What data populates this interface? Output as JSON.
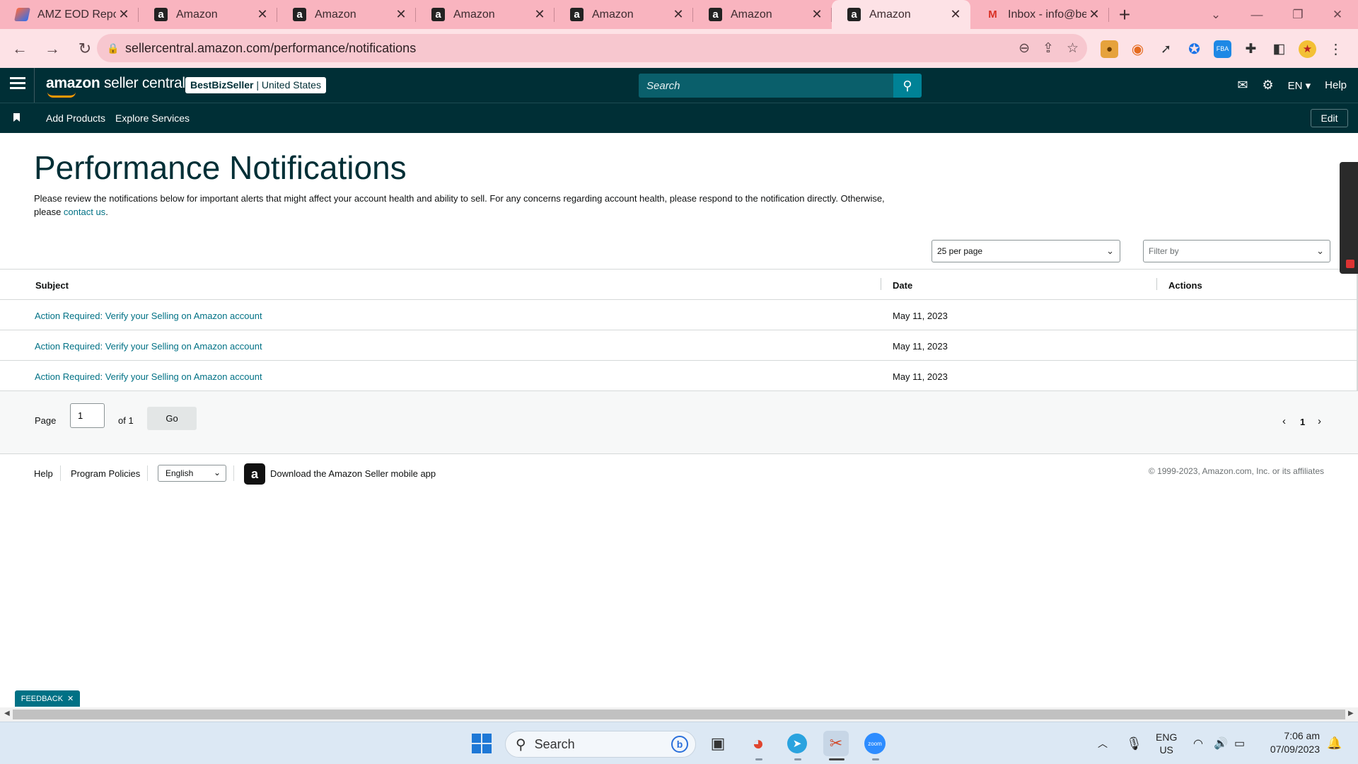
{
  "browser": {
    "tabs": [
      {
        "title": "AMZ EOD Report",
        "icon": "eod-report-favicon"
      },
      {
        "title": "Amazon",
        "icon": "amazon-favicon"
      },
      {
        "title": "Amazon",
        "icon": "amazon-favicon"
      },
      {
        "title": "Amazon",
        "icon": "amazon-favicon"
      },
      {
        "title": "Amazon",
        "icon": "amazon-favicon"
      },
      {
        "title": "Amazon",
        "icon": "amazon-favicon"
      },
      {
        "title": "Amazon",
        "icon": "amazon-favicon",
        "active": true
      },
      {
        "title": "Inbox - info@bes",
        "icon": "gmail-favicon"
      }
    ],
    "url": "sellercentral.amazon.com/performance/notifications"
  },
  "header": {
    "logo_brand": "amazon",
    "logo_product": "seller central",
    "account_name": "BestBizSeller",
    "account_region": "United States",
    "search_placeholder": "Search",
    "language": "EN",
    "help_label": "Help"
  },
  "nav": {
    "links": [
      "Add Products",
      "Explore Services"
    ],
    "edit_label": "Edit"
  },
  "page": {
    "title": "Performance Notifications",
    "intro_text": "Please review the notifications below for important alerts that might affect your account health and ability to sell. For any concerns regarding account health, please respond to the notification directly. Otherwise, please ",
    "intro_link": "contact us",
    "intro_end": ".",
    "per_page": "25 per page",
    "filter_placeholder": "Filter by"
  },
  "table": {
    "columns": [
      "Subject",
      "Date",
      "Actions"
    ],
    "rows": [
      {
        "subject": "Action Required: Verify your Selling on Amazon account",
        "date": "May 11, 2023"
      },
      {
        "subject": "Action Required: Verify your Selling on Amazon account",
        "date": "May 11, 2023"
      },
      {
        "subject": "Action Required: Verify your Selling on Amazon account",
        "date": "May 11, 2023"
      }
    ]
  },
  "pager": {
    "page_label": "Page",
    "page_value": "1",
    "of_label": "of 1",
    "go_label": "Go",
    "current_page": "1"
  },
  "footer": {
    "help": "Help",
    "policies": "Program Policies",
    "language": "English",
    "app_text": "Download the Amazon Seller mobile app",
    "copyright": "© 1999-2023, Amazon.com, Inc. or its affiliates"
  },
  "feedback_label": "FEEDBACK",
  "taskbar": {
    "search_label": "Search",
    "lang_line1": "ENG",
    "lang_line2": "US",
    "time": "7:06 am",
    "date": "07/09/2023"
  },
  "colors": {
    "header_bg": "#002f36",
    "link": "#007185",
    "tab_strip": "#f9b4bf",
    "active_tab": "#fde2e6"
  }
}
